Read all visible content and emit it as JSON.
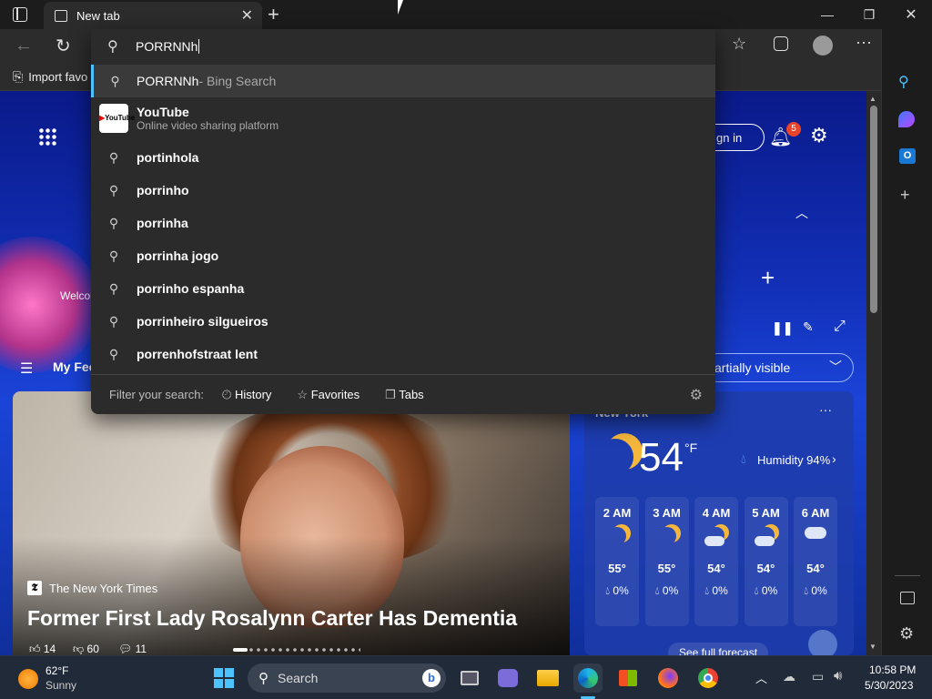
{
  "browser": {
    "tab_title": "New tab",
    "new_tab_symbol": "+",
    "fav_item": "Import favo"
  },
  "addressbar": {
    "value": "PORRNNh"
  },
  "suggestions": {
    "bing": {
      "query": "PORRNNh",
      "suffix": " - Bing Search"
    },
    "site": {
      "title": "YouTube",
      "subtitle": "Online video sharing platform",
      "logo_text": "YouTube"
    },
    "items": [
      "portinhola",
      "porrinho",
      "porrinha",
      "porrinha jogo",
      "porrinho espanha",
      "porrinheiro silgueiros",
      "porrenhofstraat lent"
    ]
  },
  "filter": {
    "label": "Filter your search:",
    "history": "History",
    "favorites": "Favorites",
    "tabs": "Tabs"
  },
  "newtab": {
    "sign_in": "gn in",
    "notification_count": "5",
    "welcome": "Welcom",
    "my_feed": "My Fee",
    "content_visibility": "artially visible"
  },
  "news": {
    "source": "The New York Times",
    "headline": "Former First Lady Rosalynn Carter Has Dementia",
    "likes": "14",
    "dislikes": "60",
    "comments": "11"
  },
  "weather": {
    "city": "New York",
    "temp": "54",
    "unit": "°F",
    "humidity": "Humidity 94%",
    "hours": [
      {
        "time": "2 AM",
        "icon": "moon-icon",
        "temp": "55°",
        "precip": "0%"
      },
      {
        "time": "3 AM",
        "icon": "moon-icon",
        "temp": "55°",
        "precip": "0%"
      },
      {
        "time": "4 AM",
        "icon": "moon-cloud-icon",
        "temp": "54°",
        "precip": "0%"
      },
      {
        "time": "5 AM",
        "icon": "moon-cloud-icon",
        "temp": "54°",
        "precip": "0%"
      },
      {
        "time": "6 AM",
        "icon": "cloud-icon",
        "temp": "54°",
        "precip": "0%"
      }
    ],
    "forecast_link": "See full forecast"
  },
  "taskbar": {
    "weather_temp": "62°F",
    "weather_desc": "Sunny",
    "search_label": "Search",
    "time": "10:58 PM",
    "date": "5/30/2023"
  },
  "colors": {
    "accent": "#4cc2ff",
    "notification_badge": "#e8442c"
  }
}
